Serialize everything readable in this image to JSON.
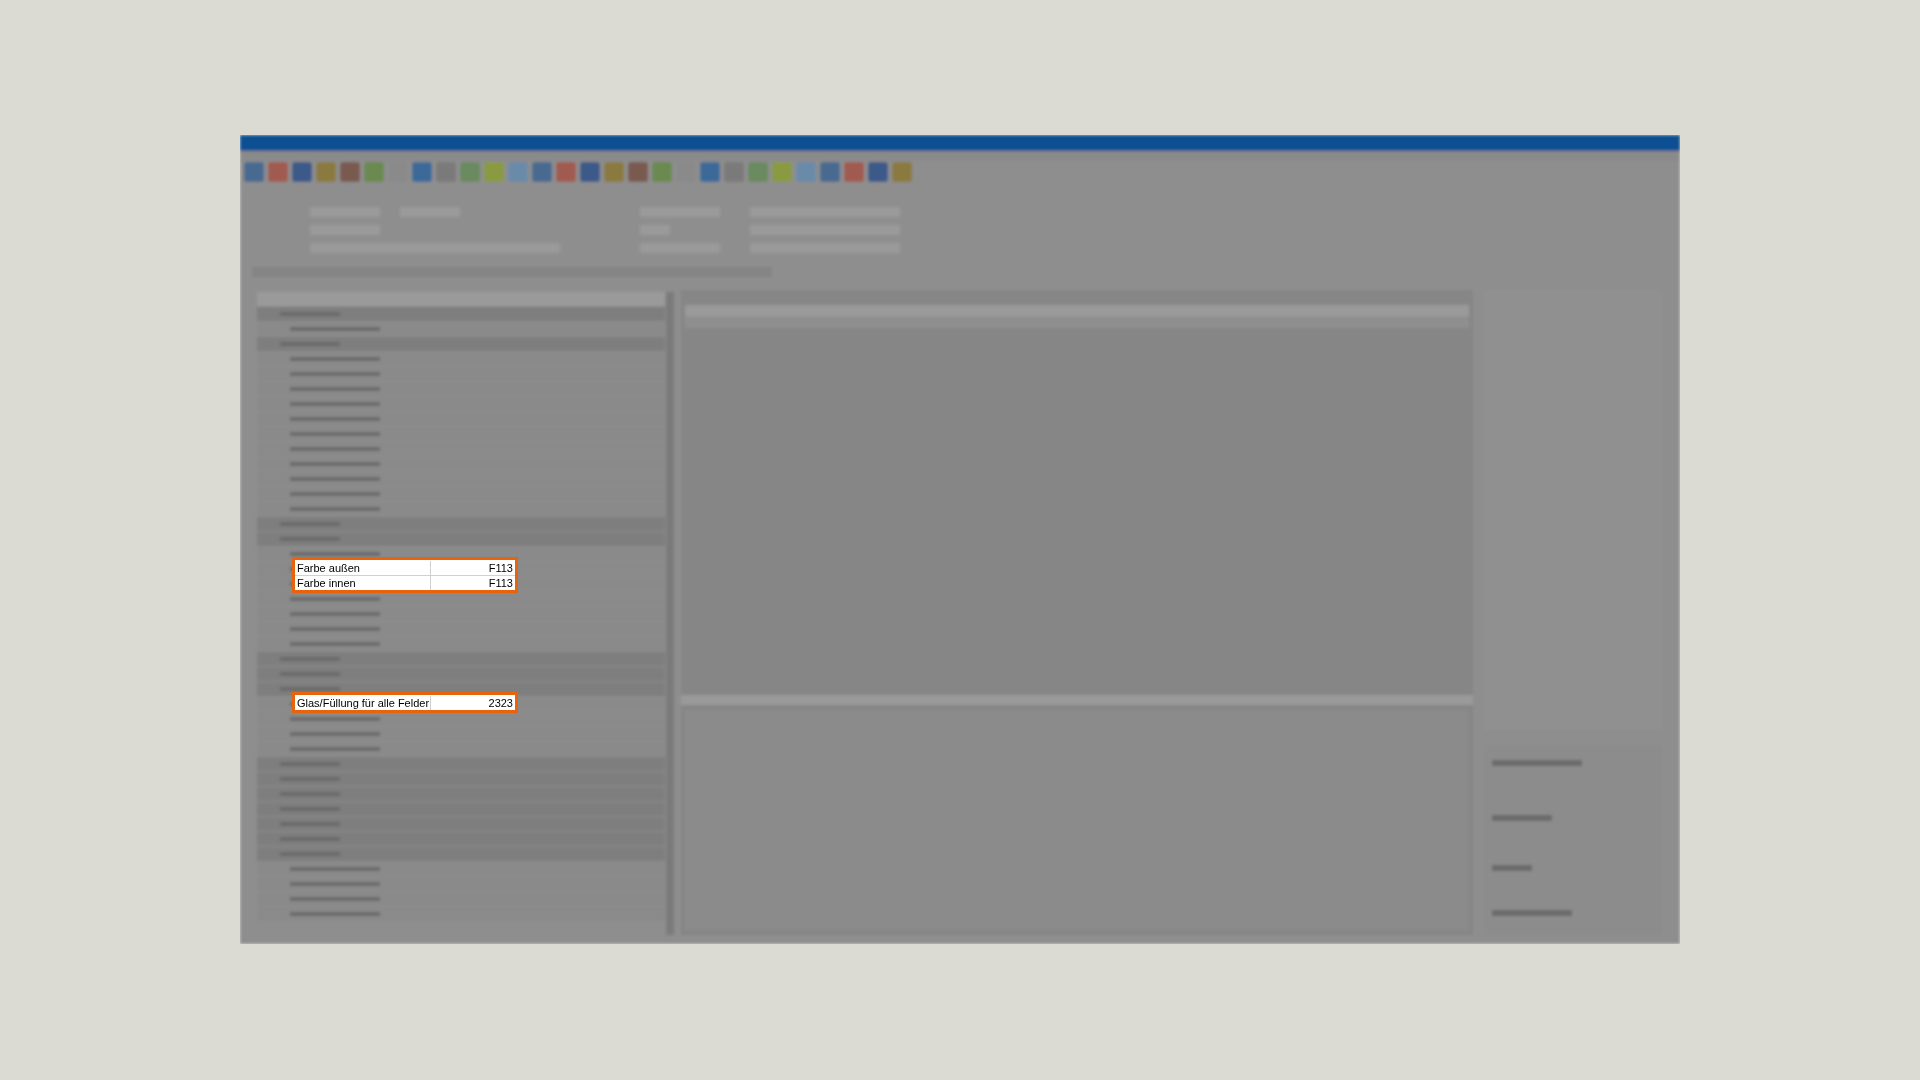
{
  "highlights": [
    {
      "rows": [
        {
          "attribute": "Farbe außen",
          "value": "F113"
        },
        {
          "attribute": "Farbe innen",
          "value": "F113"
        }
      ]
    },
    {
      "rows": [
        {
          "attribute": "Glas/Füllung für alle Felder",
          "value": "2323"
        }
      ]
    }
  ]
}
